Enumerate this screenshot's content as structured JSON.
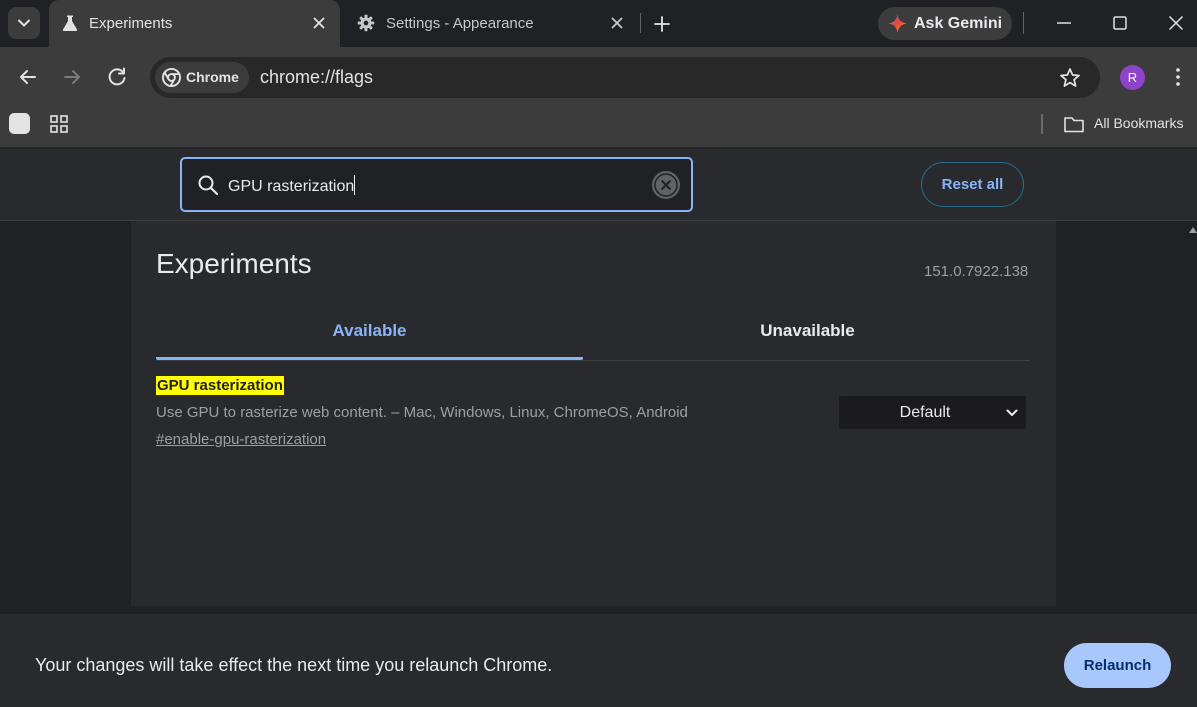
{
  "browser": {
    "tabs": [
      {
        "title": "Experiments",
        "icon": "flask-icon",
        "active": true
      },
      {
        "title": "Settings - Appearance",
        "icon": "gear-icon",
        "active": false
      }
    ],
    "gemini_label": "Ask Gemini",
    "omnibox": {
      "chip_label": "Chrome",
      "url": "chrome://flags"
    },
    "profile_initial": "R",
    "profile_color": "#8e44c9",
    "bookmarks": {
      "all_bookmarks_label": "All Bookmarks"
    }
  },
  "flags_page": {
    "search": {
      "value": "GPU rasterization",
      "placeholder": "Search flags"
    },
    "reset_all_label": "Reset all",
    "title": "Experiments",
    "version": "151.0.7922.138",
    "tabs": [
      {
        "label": "Available",
        "selected": true
      },
      {
        "label": "Unavailable",
        "selected": false
      }
    ],
    "flags": [
      {
        "name": "GPU rasterization",
        "description": "Use GPU to rasterize web content. – Mac, Windows, Linux, ChromeOS, Android",
        "link": "#enable-gpu-rasterization",
        "selected_option": "Default"
      }
    ],
    "relaunch": {
      "message": "Your changes will take effect the next time you relaunch Chrome.",
      "button_label": "Relaunch"
    }
  },
  "colors": {
    "accent": "#8ab4f8",
    "highlight": "#ffff00",
    "relaunch_button": "#a8c7fa"
  }
}
